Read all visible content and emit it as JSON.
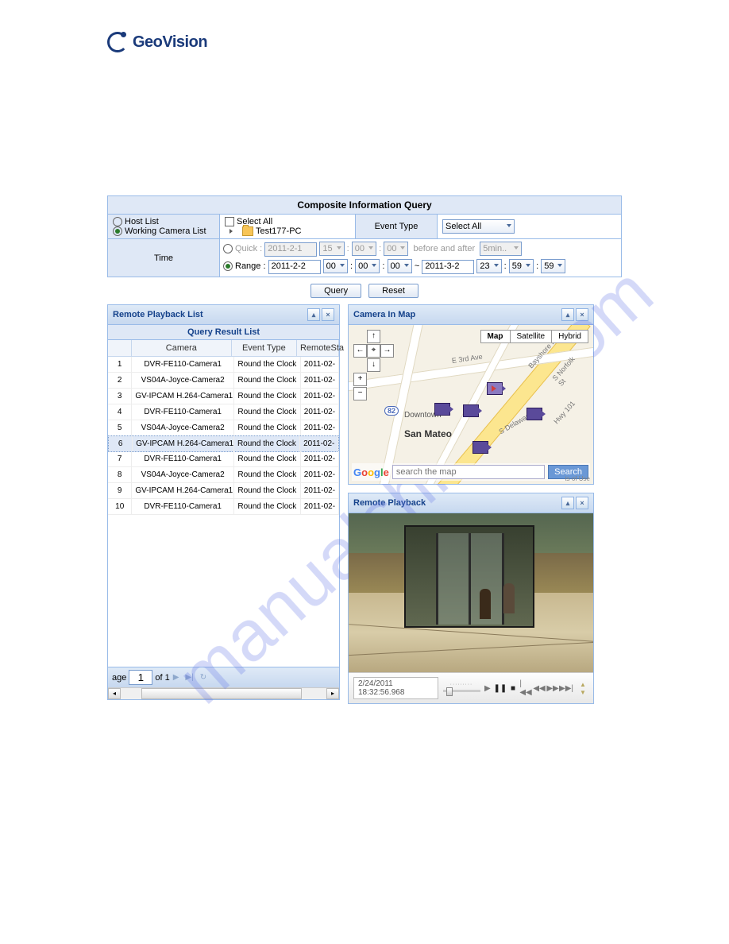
{
  "logo": {
    "text": "GeoVision"
  },
  "watermark": "manualshive . com",
  "query": {
    "title": "Composite Information Query",
    "hostList": "Host List",
    "workingCameraList": "Working Camera List",
    "listMode": "working",
    "selectAll": "Select All",
    "treeRoot": "Test177-PC",
    "eventTypeLabel": "Event Type",
    "eventTypeSelected": "Select All",
    "timeLabel": "Time",
    "quickLabel": "Quick :",
    "quickDate": "2011-2-1",
    "quickHour": "15",
    "quickMin": "00",
    "quickSec": "00",
    "beforeAfterLabel": "before and after",
    "beforeAfterVal": "5min..",
    "rangeLabel": "Range :",
    "rangeStart": "2011-2-2",
    "rsH": "00",
    "rsM": "00",
    "rsS": "00",
    "rangeEnd": "2011-3-2",
    "reH": "23",
    "reM": "59",
    "reS": "59",
    "tilde": "~",
    "timeMode": "range",
    "queryBtn": "Query",
    "resetBtn": "Reset"
  },
  "playbackList": {
    "panelTitle": "Remote Playback List",
    "subTitle": "Query Result List",
    "cols": {
      "camera": "Camera",
      "eventType": "Event Type",
      "remoteStart": "RemoteSta"
    },
    "rows": [
      {
        "n": "1",
        "cam": "DVR-FE110-Camera1",
        "ev": "Round the Clock",
        "ts": "2011-02-"
      },
      {
        "n": "2",
        "cam": "VS04A-Joyce-Camera2",
        "ev": "Round the Clock",
        "ts": "2011-02-"
      },
      {
        "n": "3",
        "cam": "GV-IPCAM H.264-Camera1",
        "ev": "Round the Clock",
        "ts": "2011-02-"
      },
      {
        "n": "4",
        "cam": "DVR-FE110-Camera1",
        "ev": "Round the Clock",
        "ts": "2011-02-"
      },
      {
        "n": "5",
        "cam": "VS04A-Joyce-Camera2",
        "ev": "Round the Clock",
        "ts": "2011-02-"
      },
      {
        "n": "6",
        "cam": "GV-IPCAM H.264-Camera1",
        "ev": "Round the Clock",
        "ts": "2011-02-"
      },
      {
        "n": "7",
        "cam": "DVR-FE110-Camera1",
        "ev": "Round the Clock",
        "ts": "2011-02-"
      },
      {
        "n": "8",
        "cam": "VS04A-Joyce-Camera2",
        "ev": "Round the Clock",
        "ts": "2011-02-"
      },
      {
        "n": "9",
        "cam": "GV-IPCAM H.264-Camera1",
        "ev": "Round the Clock",
        "ts": "2011-02-"
      },
      {
        "n": "10",
        "cam": "DVR-FE110-Camera1",
        "ev": "Round the Clock",
        "ts": "2011-02-"
      }
    ],
    "selectedIndex": 5,
    "pager": {
      "pageLabel": "age",
      "page": "1",
      "of": "of 1"
    }
  },
  "mapPanel": {
    "title": "Camera In Map",
    "types": {
      "map": "Map",
      "satellite": "Satellite",
      "hybrid": "Hybrid"
    },
    "activeType": "map",
    "searchPlaceholder": "search the map",
    "searchBtn": "Search",
    "terms": "ts of Use",
    "googleLogo": "Google",
    "places": {
      "sanMateo": "San Mateo",
      "downtown": "Downtown"
    },
    "roads": {
      "third": "E 3rd Ave",
      "bayshore": "Bayshore Fwy",
      "norfolk": "S Norfolk St",
      "delaware": "S Delaware St",
      "hwy101": "Hwy 101"
    },
    "route82": "82"
  },
  "playbackPanel": {
    "title": "Remote Playback",
    "timestamp": "2/24/2011 18:32:56.968"
  }
}
